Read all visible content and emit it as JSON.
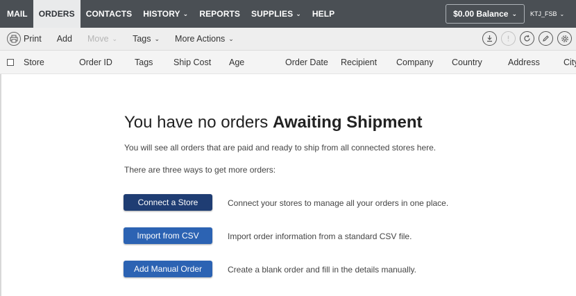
{
  "topnav": {
    "items": [
      {
        "label": "MAIL"
      },
      {
        "label": "ORDERS",
        "active": true
      },
      {
        "label": "CONTACTS"
      },
      {
        "label": "HISTORY",
        "dropdown": true
      },
      {
        "label": "REPORTS"
      },
      {
        "label": "SUPPLIES",
        "dropdown": true
      },
      {
        "label": "HELP"
      }
    ],
    "balance_label": "$0.00 Balance",
    "user_label": "KTJ_FSB"
  },
  "toolbar": {
    "print_label": "Print",
    "add_label": "Add",
    "move_label": "Move",
    "tags_label": "Tags",
    "more_actions_label": "More Actions",
    "icons": [
      "download-icon",
      "alert-icon",
      "refresh-icon",
      "edit-icon",
      "settings-icon"
    ]
  },
  "columns": [
    "Store",
    "Order ID",
    "Tags",
    "Ship Cost",
    "Age",
    "Order Date",
    "Recipient",
    "Company",
    "Country",
    "Address",
    "City"
  ],
  "empty_state": {
    "title_prefix": "You have no orders ",
    "title_bold": "Awaiting Shipment",
    "description": "You will see all orders that are paid and ready to ship from all connected stores here.",
    "ways_text": "There are three ways to get more orders:",
    "options": [
      {
        "button": "Connect a Store",
        "text": "Connect your stores to manage all your orders in one place."
      },
      {
        "button": "Import from CSV",
        "text": "Import order information from a standard CSV file."
      },
      {
        "button": "Add Manual Order",
        "text": "Create a blank order and fill in the details manually."
      }
    ]
  },
  "colors": {
    "nav_bg": "#4a4f54",
    "button_dark": "#1f3d73",
    "button_blue": "#2c63b3"
  }
}
